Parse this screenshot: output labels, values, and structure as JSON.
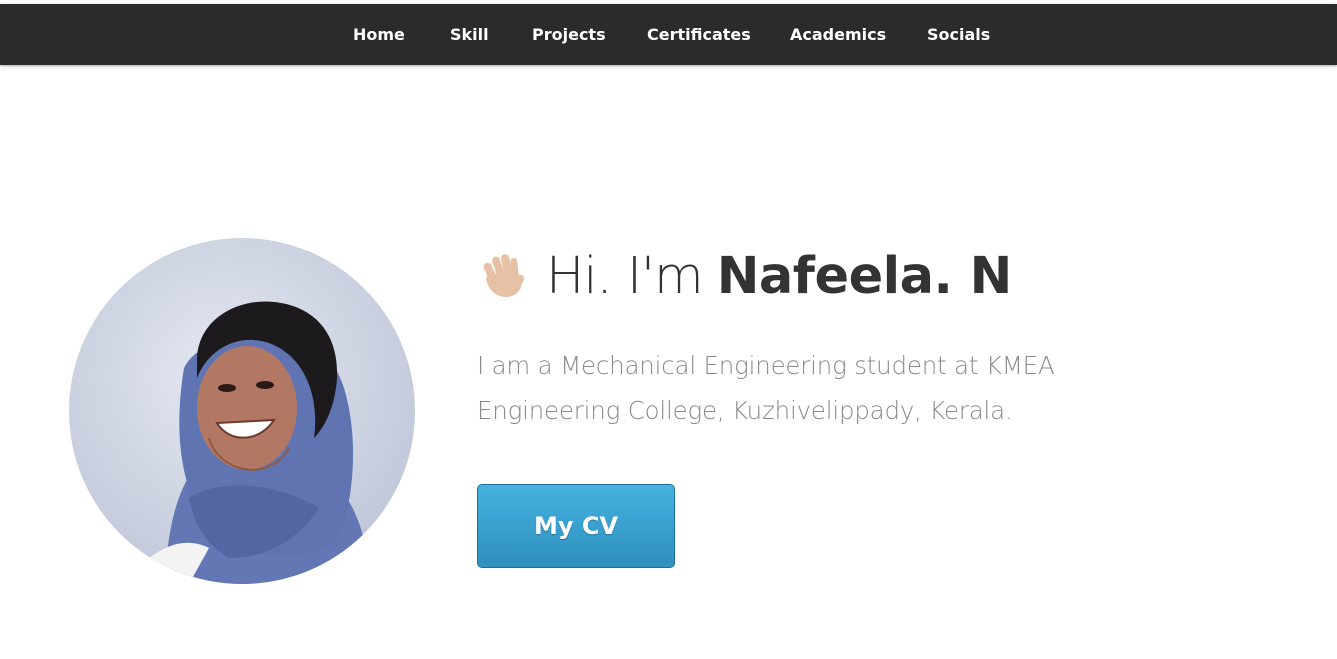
{
  "nav": {
    "items": [
      {
        "label": "Home"
      },
      {
        "label": "Skill"
      },
      {
        "label": "Projects"
      },
      {
        "label": "Certificates"
      },
      {
        "label": "Academics"
      },
      {
        "label": "Socials"
      }
    ]
  },
  "hero": {
    "greeting_prefix": "Hi. I'm",
    "name": "Nafeela. N",
    "wave_icon": "waving-hand-icon",
    "intro": "I am a Mechanical Engineering student at KMEA Engineering College, Kuzhivelippady, Kerala.",
    "cv_button_label": "My CV",
    "accent_color": "#3a9fd0"
  }
}
